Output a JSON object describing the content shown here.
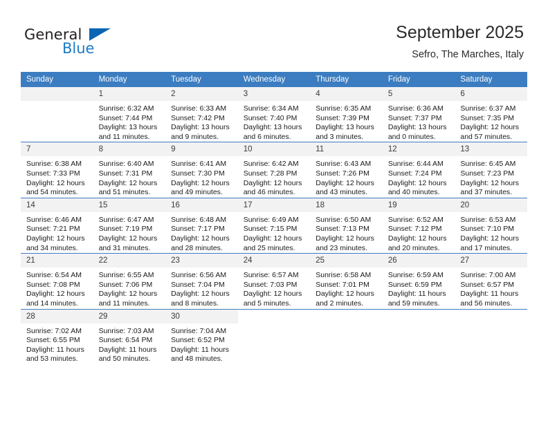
{
  "brand": {
    "name_top": "General",
    "name_bottom": "Blue",
    "triangle_color": "#0a66b2",
    "text_color": "#231f20",
    "blue_color": "#1f7ac4"
  },
  "header": {
    "title": "September 2025",
    "subtitle": "Sefro, The Marches, Italy"
  },
  "calendar": {
    "header_bg": "#3b7dc0",
    "daynum_bg": "#f2f2f2",
    "weekdays": [
      "Sunday",
      "Monday",
      "Tuesday",
      "Wednesday",
      "Thursday",
      "Friday",
      "Saturday"
    ],
    "weeks": [
      [
        {
          "day": "",
          "empty": true,
          "lines": []
        },
        {
          "day": "1",
          "lines": [
            "Sunrise: 6:32 AM",
            "Sunset: 7:44 PM",
            "Daylight: 13 hours",
            "and 11 minutes."
          ]
        },
        {
          "day": "2",
          "lines": [
            "Sunrise: 6:33 AM",
            "Sunset: 7:42 PM",
            "Daylight: 13 hours",
            "and 9 minutes."
          ]
        },
        {
          "day": "3",
          "lines": [
            "Sunrise: 6:34 AM",
            "Sunset: 7:40 PM",
            "Daylight: 13 hours",
            "and 6 minutes."
          ]
        },
        {
          "day": "4",
          "lines": [
            "Sunrise: 6:35 AM",
            "Sunset: 7:39 PM",
            "Daylight: 13 hours",
            "and 3 minutes."
          ]
        },
        {
          "day": "5",
          "lines": [
            "Sunrise: 6:36 AM",
            "Sunset: 7:37 PM",
            "Daylight: 13 hours",
            "and 0 minutes."
          ]
        },
        {
          "day": "6",
          "lines": [
            "Sunrise: 6:37 AM",
            "Sunset: 7:35 PM",
            "Daylight: 12 hours",
            "and 57 minutes."
          ]
        }
      ],
      [
        {
          "day": "7",
          "lines": [
            "Sunrise: 6:38 AM",
            "Sunset: 7:33 PM",
            "Daylight: 12 hours",
            "and 54 minutes."
          ]
        },
        {
          "day": "8",
          "lines": [
            "Sunrise: 6:40 AM",
            "Sunset: 7:31 PM",
            "Daylight: 12 hours",
            "and 51 minutes."
          ]
        },
        {
          "day": "9",
          "lines": [
            "Sunrise: 6:41 AM",
            "Sunset: 7:30 PM",
            "Daylight: 12 hours",
            "and 49 minutes."
          ]
        },
        {
          "day": "10",
          "lines": [
            "Sunrise: 6:42 AM",
            "Sunset: 7:28 PM",
            "Daylight: 12 hours",
            "and 46 minutes."
          ]
        },
        {
          "day": "11",
          "lines": [
            "Sunrise: 6:43 AM",
            "Sunset: 7:26 PM",
            "Daylight: 12 hours",
            "and 43 minutes."
          ]
        },
        {
          "day": "12",
          "lines": [
            "Sunrise: 6:44 AM",
            "Sunset: 7:24 PM",
            "Daylight: 12 hours",
            "and 40 minutes."
          ]
        },
        {
          "day": "13",
          "lines": [
            "Sunrise: 6:45 AM",
            "Sunset: 7:23 PM",
            "Daylight: 12 hours",
            "and 37 minutes."
          ]
        }
      ],
      [
        {
          "day": "14",
          "lines": [
            "Sunrise: 6:46 AM",
            "Sunset: 7:21 PM",
            "Daylight: 12 hours",
            "and 34 minutes."
          ]
        },
        {
          "day": "15",
          "lines": [
            "Sunrise: 6:47 AM",
            "Sunset: 7:19 PM",
            "Daylight: 12 hours",
            "and 31 minutes."
          ]
        },
        {
          "day": "16",
          "lines": [
            "Sunrise: 6:48 AM",
            "Sunset: 7:17 PM",
            "Daylight: 12 hours",
            "and 28 minutes."
          ]
        },
        {
          "day": "17",
          "lines": [
            "Sunrise: 6:49 AM",
            "Sunset: 7:15 PM",
            "Daylight: 12 hours",
            "and 25 minutes."
          ]
        },
        {
          "day": "18",
          "lines": [
            "Sunrise: 6:50 AM",
            "Sunset: 7:13 PM",
            "Daylight: 12 hours",
            "and 23 minutes."
          ]
        },
        {
          "day": "19",
          "lines": [
            "Sunrise: 6:52 AM",
            "Sunset: 7:12 PM",
            "Daylight: 12 hours",
            "and 20 minutes."
          ]
        },
        {
          "day": "20",
          "lines": [
            "Sunrise: 6:53 AM",
            "Sunset: 7:10 PM",
            "Daylight: 12 hours",
            "and 17 minutes."
          ]
        }
      ],
      [
        {
          "day": "21",
          "lines": [
            "Sunrise: 6:54 AM",
            "Sunset: 7:08 PM",
            "Daylight: 12 hours",
            "and 14 minutes."
          ]
        },
        {
          "day": "22",
          "lines": [
            "Sunrise: 6:55 AM",
            "Sunset: 7:06 PM",
            "Daylight: 12 hours",
            "and 11 minutes."
          ]
        },
        {
          "day": "23",
          "lines": [
            "Sunrise: 6:56 AM",
            "Sunset: 7:04 PM",
            "Daylight: 12 hours",
            "and 8 minutes."
          ]
        },
        {
          "day": "24",
          "lines": [
            "Sunrise: 6:57 AM",
            "Sunset: 7:03 PM",
            "Daylight: 12 hours",
            "and 5 minutes."
          ]
        },
        {
          "day": "25",
          "lines": [
            "Sunrise: 6:58 AM",
            "Sunset: 7:01 PM",
            "Daylight: 12 hours",
            "and 2 minutes."
          ]
        },
        {
          "day": "26",
          "lines": [
            "Sunrise: 6:59 AM",
            "Sunset: 6:59 PM",
            "Daylight: 11 hours",
            "and 59 minutes."
          ]
        },
        {
          "day": "27",
          "lines": [
            "Sunrise: 7:00 AM",
            "Sunset: 6:57 PM",
            "Daylight: 11 hours",
            "and 56 minutes."
          ]
        }
      ],
      [
        {
          "day": "28",
          "lines": [
            "Sunrise: 7:02 AM",
            "Sunset: 6:55 PM",
            "Daylight: 11 hours",
            "and 53 minutes."
          ]
        },
        {
          "day": "29",
          "lines": [
            "Sunrise: 7:03 AM",
            "Sunset: 6:54 PM",
            "Daylight: 11 hours",
            "and 50 minutes."
          ]
        },
        {
          "day": "30",
          "lines": [
            "Sunrise: 7:04 AM",
            "Sunset: 6:52 PM",
            "Daylight: 11 hours",
            "and 48 minutes."
          ]
        },
        {
          "day": "",
          "blank": true,
          "lines": []
        },
        {
          "day": "",
          "blank": true,
          "lines": []
        },
        {
          "day": "",
          "blank": true,
          "lines": []
        },
        {
          "day": "",
          "blank": true,
          "lines": []
        }
      ]
    ]
  }
}
